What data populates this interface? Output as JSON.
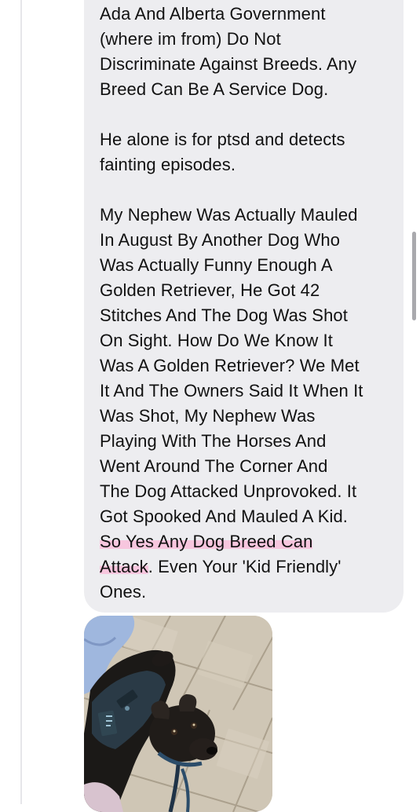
{
  "message": {
    "paragraph_1": "Ada And Alberta Government\n(where im from) Do Not\nDiscriminate Against Breeds. Any\nBreed Can Be A Service Dog.",
    "paragraph_2": "He alone is for ptsd and detects\nfainting episodes.",
    "paragraph_3_main": "My Nephew Was Actually Mauled\nIn August By Another Dog Who\nWas Actually Funny Enough A\nGolden Retriever, He Got 42\nStitches And The Dog Was Shot\nOn Sight. How Do We Know It\nWas A Golden Retriever? We Met\nIt And The Owners Said It When It\nWas Shot, My Nephew Was\nPlaying With The Horses And\nWent Around The Corner And\nThe Dog Attacked Unprovoked. It\nGot Spooked And Mauled A Kid.\n",
    "paragraph_3_highlight": "So Yes Any Dog Breed Can\nAttack",
    "paragraph_3_end": ". Even Your 'Kid Friendly'\nOnes."
  },
  "colors": {
    "bubble_background": "#ededf0",
    "highlight": "#f7c6de",
    "text": "#111111"
  }
}
